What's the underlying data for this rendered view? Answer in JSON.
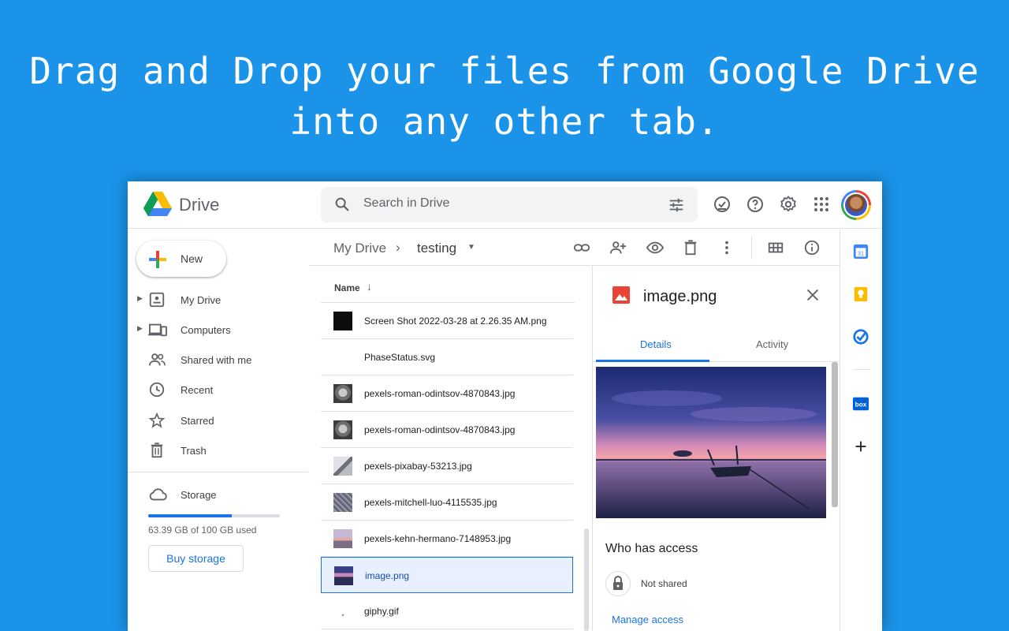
{
  "headline": {
    "line1": "Drag and Drop your files from Google Drive",
    "line2": "into any other tab."
  },
  "app": {
    "name": "Drive"
  },
  "search": {
    "placeholder": "Search in Drive"
  },
  "topbar_icons": [
    "ready-for-offline-icon",
    "help-icon",
    "settings-icon",
    "apps-grid-icon"
  ],
  "new_button": {
    "label": "New"
  },
  "sidebar": {
    "items": [
      {
        "label": "My Drive",
        "icon": "my-drive-icon",
        "expandable": true
      },
      {
        "label": "Computers",
        "icon": "computers-icon",
        "expandable": true
      },
      {
        "label": "Shared with me",
        "icon": "shared-icon",
        "expandable": false
      },
      {
        "label": "Recent",
        "icon": "clock-icon",
        "expandable": false
      },
      {
        "label": "Starred",
        "icon": "star-icon",
        "expandable": false
      },
      {
        "label": "Trash",
        "icon": "trash-icon",
        "expandable": false
      }
    ],
    "storage_label": "Storage",
    "storage_used_text": "63.39 GB of 100 GB used",
    "storage_fraction": 0.634,
    "buy_storage_label": "Buy storage"
  },
  "breadcrumb": {
    "root": "My Drive",
    "separator": "›",
    "current": "testing"
  },
  "toolbar_icons": [
    "link-icon",
    "share-icon",
    "preview-icon",
    "trash-icon",
    "more-icon",
    "grid-view-icon",
    "info-icon"
  ],
  "file_list": {
    "header_label": "Name",
    "sort_arrow": "↓",
    "files": [
      {
        "name": "Screen Shot 2022-03-28 at 2.26.35 AM.png",
        "thumb": "dark"
      },
      {
        "name": "PhaseStatus.svg",
        "thumb": "none"
      },
      {
        "name": "pexels-roman-odintsov-4870843.jpg",
        "thumb": "statue"
      },
      {
        "name": "pexels-roman-odintsov-4870843.jpg",
        "thumb": "statue"
      },
      {
        "name": "pexels-pixabay-53213.jpg",
        "thumb": "light"
      },
      {
        "name": "pexels-mitchell-luo-4115535.jpg",
        "thumb": "gravel"
      },
      {
        "name": "pexels-kehn-hermano-7148953.jpg",
        "thumb": "sunset"
      },
      {
        "name": "image.png",
        "thumb": "boat",
        "selected": true
      },
      {
        "name": "giphy.gif",
        "thumb": "none"
      }
    ]
  },
  "details": {
    "title": "image.png",
    "tab_details": "Details",
    "tab_activity": "Activity",
    "who_has_access": "Who has access",
    "access_status": "Not shared",
    "manage_access": "Manage access"
  },
  "side_rail": [
    "calendar-icon",
    "keep-icon",
    "tasks-icon",
    "box-icon",
    "add-icon"
  ],
  "colors": {
    "background": "#1a93e8",
    "accent": "#1a73e8",
    "selected_row": "#e8f0fe"
  }
}
